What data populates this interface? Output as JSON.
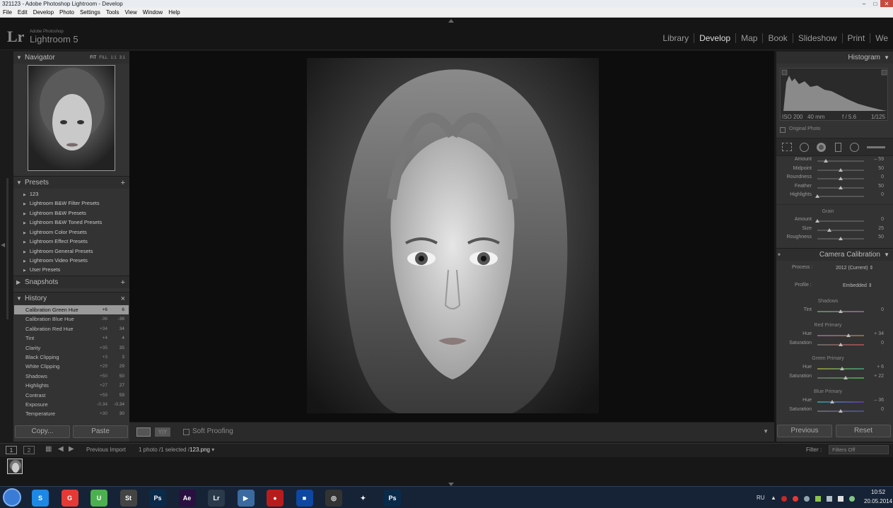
{
  "window": {
    "title": "321123 - Adobe Photoshop Lightroom - Develop"
  },
  "menu": [
    "File",
    "Edit",
    "Develop",
    "Photo",
    "Settings",
    "Tools",
    "View",
    "Window",
    "Help"
  ],
  "identity": {
    "logo": "Lr",
    "sub": "Adobe Photoshop",
    "name": "Lightroom 5"
  },
  "modules": [
    "Library",
    "Develop",
    "Map",
    "Book",
    "Slideshow",
    "Print",
    "We"
  ],
  "navigator": {
    "title": "Navigator",
    "zoom": [
      "FIT",
      "FILL",
      "1:1",
      "3:1"
    ]
  },
  "presets": {
    "title": "Presets",
    "items": [
      "123",
      "Lightroom B&W Filter Presets",
      "Lightroom B&W Presets",
      "Lightroom B&W Toned Presets",
      "Lightroom Color Presets",
      "Lightroom Effect Presets",
      "Lightroom General Presets",
      "Lightroom Video Presets",
      "User Presets"
    ]
  },
  "snapshots": {
    "title": "Snapshots"
  },
  "history": {
    "title": "History",
    "items": [
      {
        "label": "Calibration Green Hue",
        "d": "+6",
        "v": "6"
      },
      {
        "label": "Calibration Blue Hue",
        "d": "-36",
        "v": "-36"
      },
      {
        "label": "Calibration Red Hue",
        "d": "+34",
        "v": "34"
      },
      {
        "label": "Tint",
        "d": "+4",
        "v": "4"
      },
      {
        "label": "Clarity",
        "d": "+35",
        "v": "35"
      },
      {
        "label": "Black Clipping",
        "d": "+3",
        "v": "3"
      },
      {
        "label": "White Clipping",
        "d": "+29",
        "v": "29"
      },
      {
        "label": "Shadows",
        "d": "+50",
        "v": "50"
      },
      {
        "label": "Highlights",
        "d": "+27",
        "v": "27"
      },
      {
        "label": "Contrast",
        "d": "+59",
        "v": "59"
      },
      {
        "label": "Exposure",
        "d": "-0.34",
        "v": "-0.34"
      },
      {
        "label": "Temperature",
        "d": "+30",
        "v": "30"
      }
    ]
  },
  "left_buttons": {
    "copy": "Copy...",
    "paste": "Paste"
  },
  "toolbar": {
    "soft_proofing": "Soft Proofing"
  },
  "histogram": {
    "title": "Histogram",
    "iso": "ISO 200",
    "focal": "40 mm",
    "aperture": "f / 5.6",
    "shutter": "1/125",
    "original": "Original Photo"
  },
  "effects": {
    "vignette": [
      {
        "label": "Amount",
        "value": "– 59",
        "pos": 0.18
      },
      {
        "label": "Midpoint",
        "value": "50",
        "pos": 0.5
      },
      {
        "label": "Roundness",
        "value": "0",
        "pos": 0.5
      },
      {
        "label": "Feather",
        "value": "50",
        "pos": 0.5
      },
      {
        "label": "Highlights",
        "value": "0",
        "pos": 0.0
      }
    ],
    "grain_title": "Grain",
    "grain": [
      {
        "label": "Amount",
        "value": "0",
        "pos": 0.0
      },
      {
        "label": "Size",
        "value": "25",
        "pos": 0.25
      },
      {
        "label": "Roughness",
        "value": "50",
        "pos": 0.5
      }
    ]
  },
  "calibration": {
    "title": "Camera Calibration",
    "process_label": "Process :",
    "process_value": "2012 (Current)",
    "profile_label": "Profile :",
    "profile_value": "Embedded",
    "shadows_title": "Shadows",
    "tint": {
      "label": "Tint",
      "value": "0",
      "pos": 0.5
    },
    "red_title": "Red Primary",
    "red": [
      {
        "label": "Hue",
        "value": "+ 34",
        "pos": 0.67
      },
      {
        "label": "Saturation",
        "value": "0",
        "pos": 0.5
      }
    ],
    "green_title": "Green Primary",
    "green": [
      {
        "label": "Hue",
        "value": "+ 6",
        "pos": 0.53
      },
      {
        "label": "Saturation",
        "value": "+ 22",
        "pos": 0.61
      }
    ],
    "blue_title": "Blue Primary",
    "blue": [
      {
        "label": "Hue",
        "value": "– 36",
        "pos": 0.32
      },
      {
        "label": "Saturation",
        "value": "0",
        "pos": 0.5
      }
    ]
  },
  "right_buttons": {
    "previous": "Previous",
    "reset": "Reset"
  },
  "filmstrip": {
    "source": "Previous Import",
    "count": "1 photo /1 selected /",
    "file": "123.png",
    "filter_label": "Filter :",
    "filter_value": "Filters Off",
    "page1": "1",
    "page2": "2"
  },
  "taskbar": {
    "lang": "RU",
    "time": "10:52",
    "date": "20.05.2014",
    "apps": [
      {
        "name": "S",
        "color": "#1e88e5"
      },
      {
        "name": "G",
        "color": "#e53935"
      },
      {
        "name": "U",
        "color": "#4caf50"
      },
      {
        "name": "St",
        "color": "#444"
      },
      {
        "name": "Ps",
        "color": "#0a2a4a"
      },
      {
        "name": "Ae",
        "color": "#2a1040"
      },
      {
        "name": "Lr",
        "color": "#2a3a4a"
      },
      {
        "name": "▶",
        "color": "#3a6aa0"
      },
      {
        "name": "●",
        "color": "#b71c1c"
      },
      {
        "name": "■",
        "color": "#0d47a1"
      },
      {
        "name": "◎",
        "color": "#333"
      },
      {
        "name": "✦",
        "color": "#162336"
      },
      {
        "name": "Ps",
        "color": "#0a2a4a"
      }
    ]
  }
}
